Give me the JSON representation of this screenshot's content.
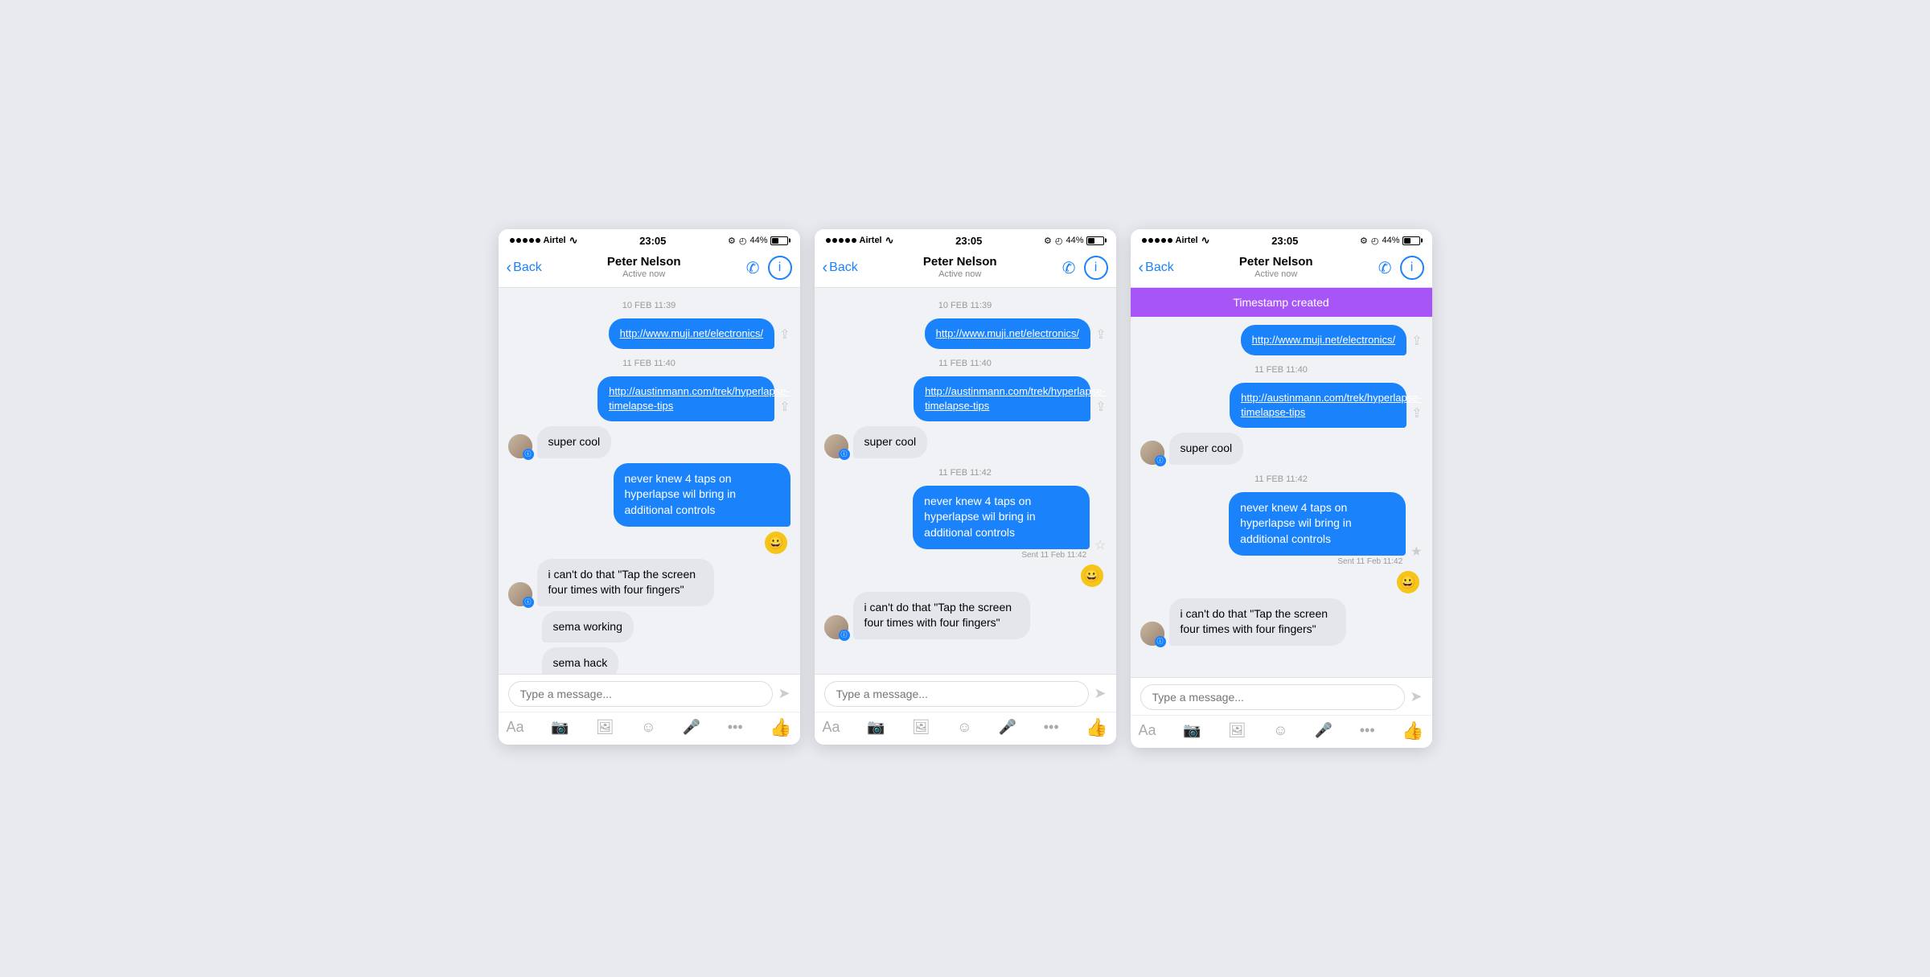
{
  "colors": {
    "blue": "#1a82fb",
    "purple": "#a855f7",
    "bubble_incoming": "#e4e6eb",
    "bubble_outgoing": "#1a82fb",
    "background": "#f0f2f5"
  },
  "phones": [
    {
      "id": "phone-1",
      "status_bar": {
        "carrier": "Airtel",
        "time": "23:05",
        "battery": "44%"
      },
      "nav": {
        "back_label": "Back",
        "name": "Peter Nelson",
        "status": "Active now"
      },
      "timestamp_banner": null,
      "messages": [
        {
          "type": "timestamp",
          "text": "10 FEB 11:39"
        },
        {
          "type": "outgoing-link",
          "text": "http://www.muji.net/electronics/"
        },
        {
          "type": "timestamp",
          "text": "11 FEB 11:40"
        },
        {
          "type": "outgoing-link",
          "text": "http://austinmann.com/trek/hyperlapse-timelapse-tips"
        },
        {
          "type": "incoming",
          "text": "super cool",
          "has_avatar": true
        },
        {
          "type": "outgoing",
          "text": "never knew 4 taps on hyperlapse wil bring in additional controls"
        },
        {
          "type": "emoji-reaction",
          "emoji": "😀"
        },
        {
          "type": "incoming",
          "text": "i can't do that \"Tap the screen four times with four fingers\"",
          "has_avatar": true
        },
        {
          "type": "incoming-no-avatar",
          "text": "sema working"
        },
        {
          "type": "incoming-no-avatar",
          "text": "sema hack"
        }
      ],
      "input_placeholder": "Type a message...",
      "toolbar_icons": [
        "Aa",
        "📷",
        "🖼",
        "😊",
        "🎤",
        "•••",
        "👍"
      ]
    },
    {
      "id": "phone-2",
      "status_bar": {
        "carrier": "Airtel",
        "time": "23:05",
        "battery": "44%"
      },
      "nav": {
        "back_label": "Back",
        "name": "Peter Nelson",
        "status": "Active now"
      },
      "timestamp_banner": null,
      "messages": [
        {
          "type": "timestamp",
          "text": "10 FEB 11:39"
        },
        {
          "type": "outgoing-link",
          "text": "http://www.muji.net/electronics/"
        },
        {
          "type": "timestamp",
          "text": "11 FEB 11:40"
        },
        {
          "type": "outgoing-link",
          "text": "http://austinmann.com/trek/hyperlapse-timelapse-tips"
        },
        {
          "type": "incoming",
          "text": "super cool",
          "has_avatar": true
        },
        {
          "type": "timestamp",
          "text": "11 FEB 11:42"
        },
        {
          "type": "outgoing-with-star",
          "text": "never knew 4 taps on hyperlapse wil bring in additional controls",
          "sent": "Sent 11 Feb 11:42"
        },
        {
          "type": "emoji-reaction-right",
          "emoji": "😀"
        },
        {
          "type": "incoming",
          "text": "i can't do that \"Tap the screen four times with four fingers\"",
          "has_avatar": true
        }
      ],
      "input_placeholder": "Type a message...",
      "toolbar_icons": [
        "Aa",
        "📷",
        "🖼",
        "😊",
        "🎤",
        "•••",
        "👍"
      ]
    },
    {
      "id": "phone-3",
      "status_bar": {
        "carrier": "Airtel",
        "time": "23:05",
        "battery": "44%"
      },
      "nav": {
        "back_label": "Back",
        "name": "Peter Nelson",
        "status": "Active now"
      },
      "timestamp_banner": "Timestamp created",
      "messages": [
        {
          "type": "outgoing-link",
          "text": "http://www.muji.net/electronics/"
        },
        {
          "type": "timestamp",
          "text": "11 FEB 11:40"
        },
        {
          "type": "outgoing-link",
          "text": "http://austinmann.com/trek/hyperlapse-timelapse-tips"
        },
        {
          "type": "incoming",
          "text": "super cool",
          "has_avatar": true
        },
        {
          "type": "timestamp",
          "text": "11 FEB 11:42"
        },
        {
          "type": "outgoing-with-star",
          "text": "never knew 4 taps on hyperlapse wil bring in additional controls",
          "sent": "Sent 11 Feb 11:42"
        },
        {
          "type": "emoji-reaction-right",
          "emoji": "😀"
        },
        {
          "type": "incoming",
          "text": "i can't do that \"Tap the screen four times with four fingers\"",
          "has_avatar": true
        }
      ],
      "input_placeholder": "Type a message...",
      "toolbar_icons": [
        "Aa",
        "📷",
        "🖼",
        "😊",
        "🎤",
        "•••",
        "👍"
      ]
    }
  ]
}
